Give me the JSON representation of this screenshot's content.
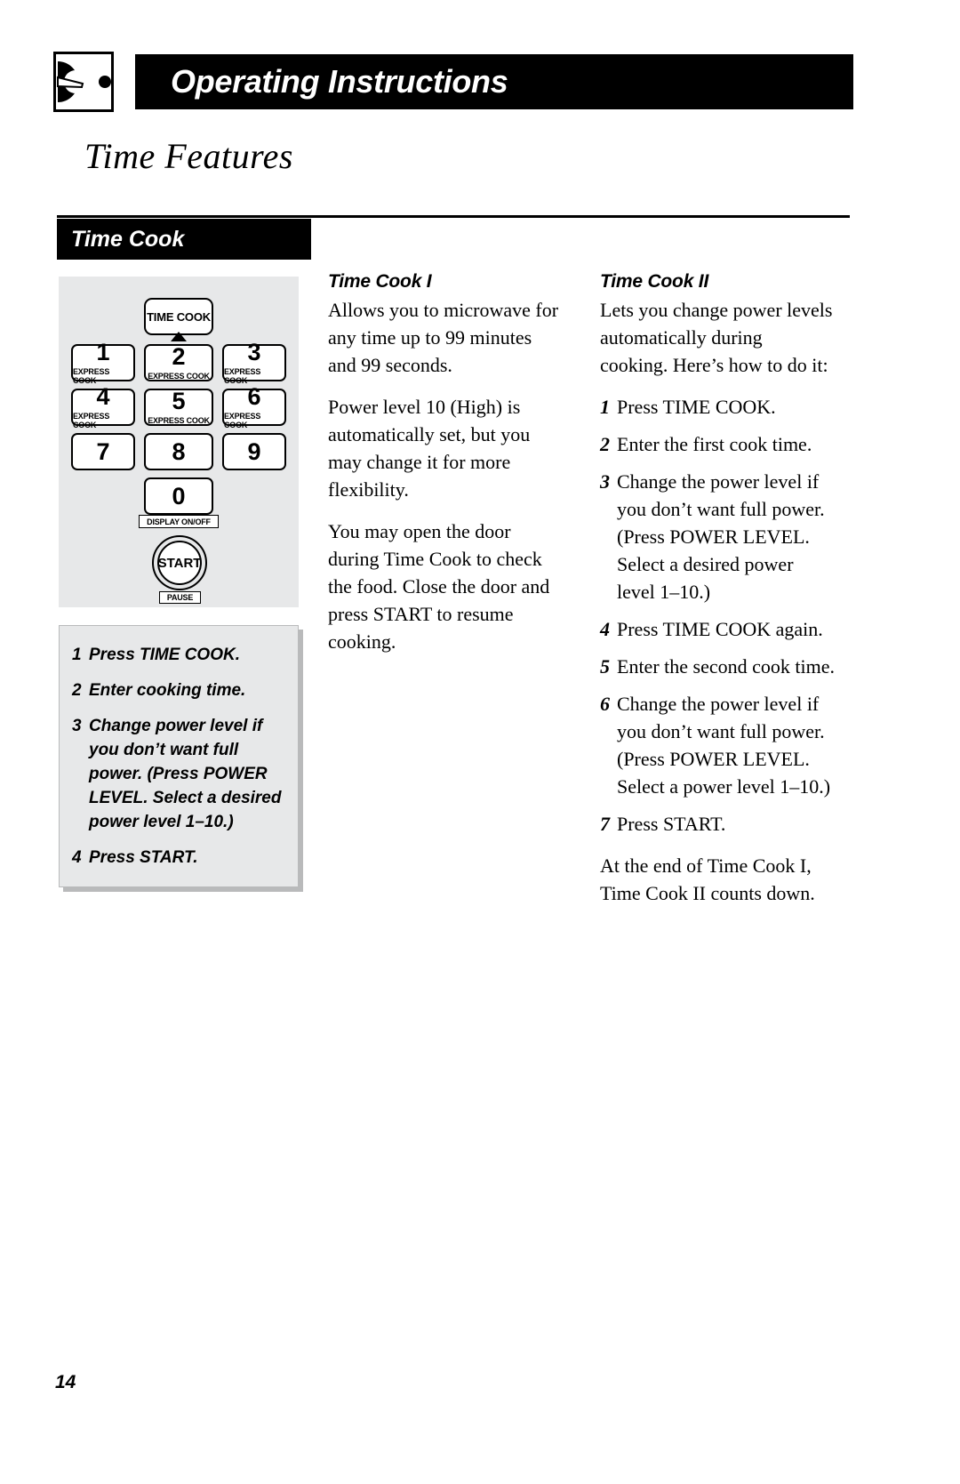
{
  "header": {
    "logo_icon": "microwave-dial-icon",
    "title": "Operating Instructions"
  },
  "chapter_title": "Time Features",
  "section": {
    "label": "Time Cook"
  },
  "keypad": {
    "time_cook_key": "TIME COOK",
    "keys": [
      {
        "num": "1",
        "sub": "EXPRESS COOK"
      },
      {
        "num": "2",
        "sub": "EXPRESS COOK"
      },
      {
        "num": "3",
        "sub": "EXPRESS COOK"
      },
      {
        "num": "4",
        "sub": "EXPRESS COOK"
      },
      {
        "num": "5",
        "sub": "EXPRESS COOK"
      },
      {
        "num": "6",
        "sub": "EXPRESS COOK"
      },
      {
        "num": "7",
        "sub": ""
      },
      {
        "num": "8",
        "sub": ""
      },
      {
        "num": "9",
        "sub": ""
      },
      {
        "num": "0",
        "sub": ""
      }
    ],
    "display_tag": "DISPLAY ON/OFF",
    "start_label": "START",
    "pause_tag": "PAUSE"
  },
  "steps_box": {
    "steps": [
      {
        "n": "1",
        "text": "Press TIME COOK."
      },
      {
        "n": "2",
        "text": "Enter cooking time."
      },
      {
        "n": "3",
        "text": "Change power level if you don’t want full power. (Press POWER LEVEL. Select a desired power level 1–10.)"
      },
      {
        "n": "4",
        "text": "Press START."
      }
    ]
  },
  "time_cook_i": {
    "heading": "Time Cook I",
    "paragraphs": [
      "Allows you to microwave for any time up to 99 minutes and 99 seconds.",
      "Power level 10 (High) is automatically set, but you may change it for more flexibility.",
      "You may open the door during Time Cook to check the food. Close the door and press START to resume cooking."
    ]
  },
  "time_cook_ii": {
    "heading": "Time Cook II",
    "intro": "Lets you change power levels automatically during cooking. Here’s how to do it:",
    "steps": [
      {
        "n": "1",
        "text": "Press TIME COOK."
      },
      {
        "n": "2",
        "text": "Enter the first cook time."
      },
      {
        "n": "3",
        "text": "Change the power level if you don’t want full power. (Press POWER LEVEL. Select a desired power level 1–10.)"
      },
      {
        "n": "4",
        "text": "Press TIME COOK again."
      },
      {
        "n": "5",
        "text": "Enter the second cook time."
      },
      {
        "n": "6",
        "text": "Change the power level if you don’t want full power. (Press POWER LEVEL. Select a power level 1–10.)"
      },
      {
        "n": "7",
        "text": "Press START."
      }
    ],
    "tail": "At the end of Time Cook I, Time Cook II counts down."
  },
  "footer": {
    "page_number": "14"
  }
}
